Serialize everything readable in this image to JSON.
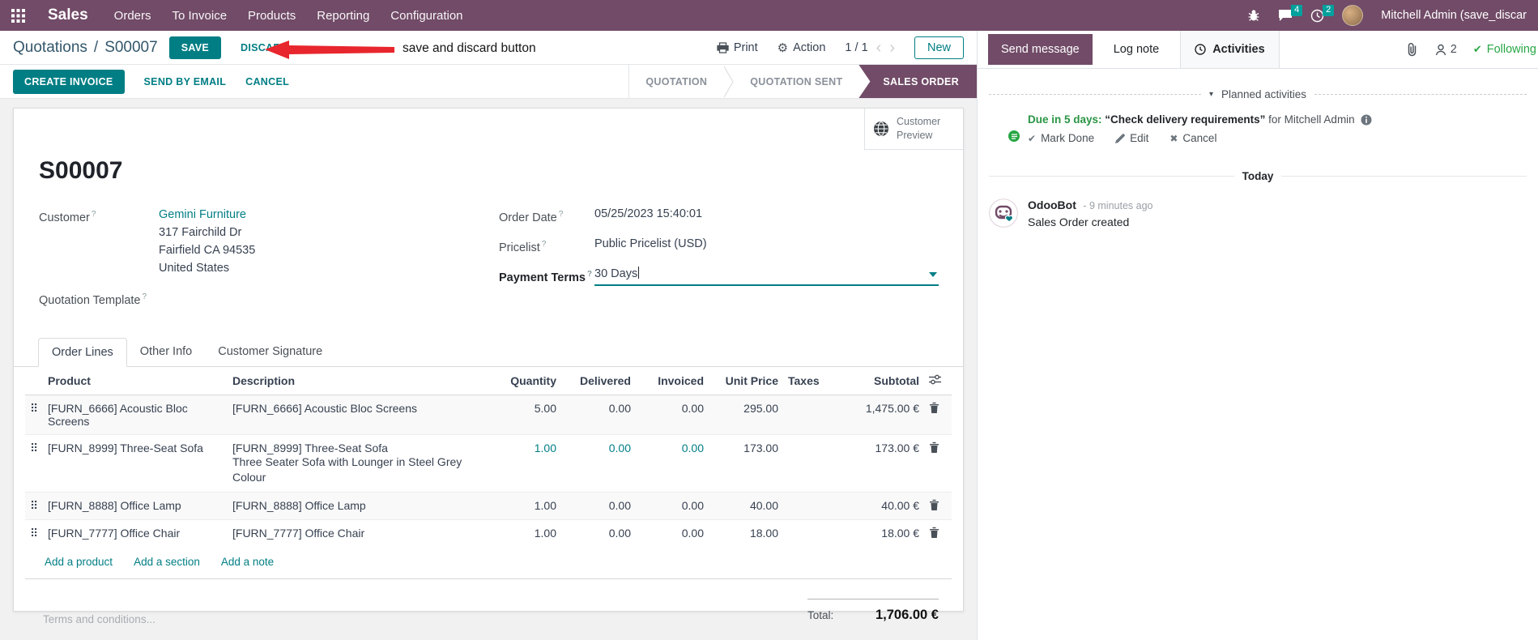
{
  "colors": {
    "navbar_bg": "#714B67",
    "primary_teal": "#017E84",
    "badge_teal": "#00A09D",
    "success_green": "#28a745",
    "annotation_red": "#e8262d"
  },
  "icons": {
    "hint": "?",
    "drag": "⠿",
    "check": "✔",
    "cross": "✖",
    "chevron_left": "‹",
    "chevron_right": "›",
    "gear": "⚙",
    "caret_down": "▾"
  },
  "navbar": {
    "app": "Sales",
    "menus": [
      "Orders",
      "To Invoice",
      "Products",
      "Reporting",
      "Configuration"
    ],
    "messages_badge": "4",
    "activities_badge": "2",
    "user": "Mitchell Admin (save_discar"
  },
  "control_panel": {
    "breadcrumb_parent": "Quotations",
    "breadcrumb_sep": "/",
    "breadcrumb_current": "S00007",
    "save": "SAVE",
    "discard": "DISCARD",
    "annotation": "save and discard button",
    "print": "Print",
    "action": "Action",
    "pager": "1 / 1",
    "new": "New"
  },
  "status_bar": {
    "create_invoice": "CREATE INVOICE",
    "send_by_email": "SEND BY EMAIL",
    "cancel": "CANCEL",
    "states": [
      "QUOTATION",
      "QUOTATION SENT",
      "SALES ORDER"
    ],
    "active_state": "SALES ORDER"
  },
  "sheet": {
    "customer_preview": "Customer Preview",
    "title": "S00007",
    "fields": {
      "customer_label": "Customer",
      "customer_name": "Gemini Furniture",
      "address_line1": "317 Fairchild Dr",
      "address_line2": "Fairfield CA 94535",
      "address_line3": "United States",
      "quotation_template_label": "Quotation Template",
      "order_date_label": "Order Date",
      "order_date": "05/25/2023 15:40:01",
      "pricelist_label": "Pricelist",
      "pricelist": "Public Pricelist (USD)",
      "payment_terms_label": "Payment Terms",
      "payment_terms": "30 Days"
    },
    "tabs": [
      "Order Lines",
      "Other Info",
      "Customer Signature"
    ],
    "active_tab": "Order Lines",
    "table": {
      "headers": [
        "Product",
        "Description",
        "Quantity",
        "Delivered",
        "Invoiced",
        "Unit Price",
        "Taxes",
        "Subtotal"
      ],
      "rows": [
        {
          "product": "[FURN_6666] Acoustic Bloc Screens",
          "description": "[FURN_6666] Acoustic Bloc Screens",
          "description2": "",
          "quantity": "5.00",
          "delivered": "0.00",
          "invoiced": "0.00",
          "unit_price": "295.00",
          "taxes": "",
          "subtotal": "1,475.00 €"
        },
        {
          "product": "[FURN_8999] Three-Seat Sofa",
          "description": "[FURN_8999] Three-Seat Sofa",
          "description2": "Three Seater Sofa with Lounger in Steel Grey Colour",
          "quantity": "1.00",
          "delivered": "0.00",
          "invoiced": "0.00",
          "unit_price": "173.00",
          "taxes": "",
          "subtotal": "173.00 €"
        },
        {
          "product": "[FURN_8888] Office Lamp",
          "description": "[FURN_8888] Office Lamp",
          "description2": "",
          "quantity": "1.00",
          "delivered": "0.00",
          "invoiced": "0.00",
          "unit_price": "40.00",
          "taxes": "",
          "subtotal": "40.00 €"
        },
        {
          "product": "[FURN_7777] Office Chair",
          "description": "[FURN_7777] Office Chair",
          "description2": "",
          "quantity": "1.00",
          "delivered": "0.00",
          "invoiced": "0.00",
          "unit_price": "18.00",
          "taxes": "",
          "subtotal": "18.00 €"
        }
      ],
      "links": [
        "Add a product",
        "Add a section",
        "Add a note"
      ]
    },
    "terms_placeholder": "Terms and conditions...",
    "total_label": "Total:",
    "total": "1,706.00 €"
  },
  "chatter": {
    "send_message": "Send message",
    "log_note": "Log note",
    "activities": "Activities",
    "followers_count": "2",
    "following": "Following",
    "planned": "Planned activities",
    "activity": {
      "due": "Due in 5 days:",
      "summary": "“Check delivery requirements”",
      "assignee": "for Mitchell Admin",
      "mark_done": "Mark Done",
      "edit": "Edit",
      "cancel": "Cancel"
    },
    "today": "Today",
    "message": {
      "author": "OdooBot",
      "time": "- 9 minutes ago",
      "body": "Sales Order created"
    }
  }
}
